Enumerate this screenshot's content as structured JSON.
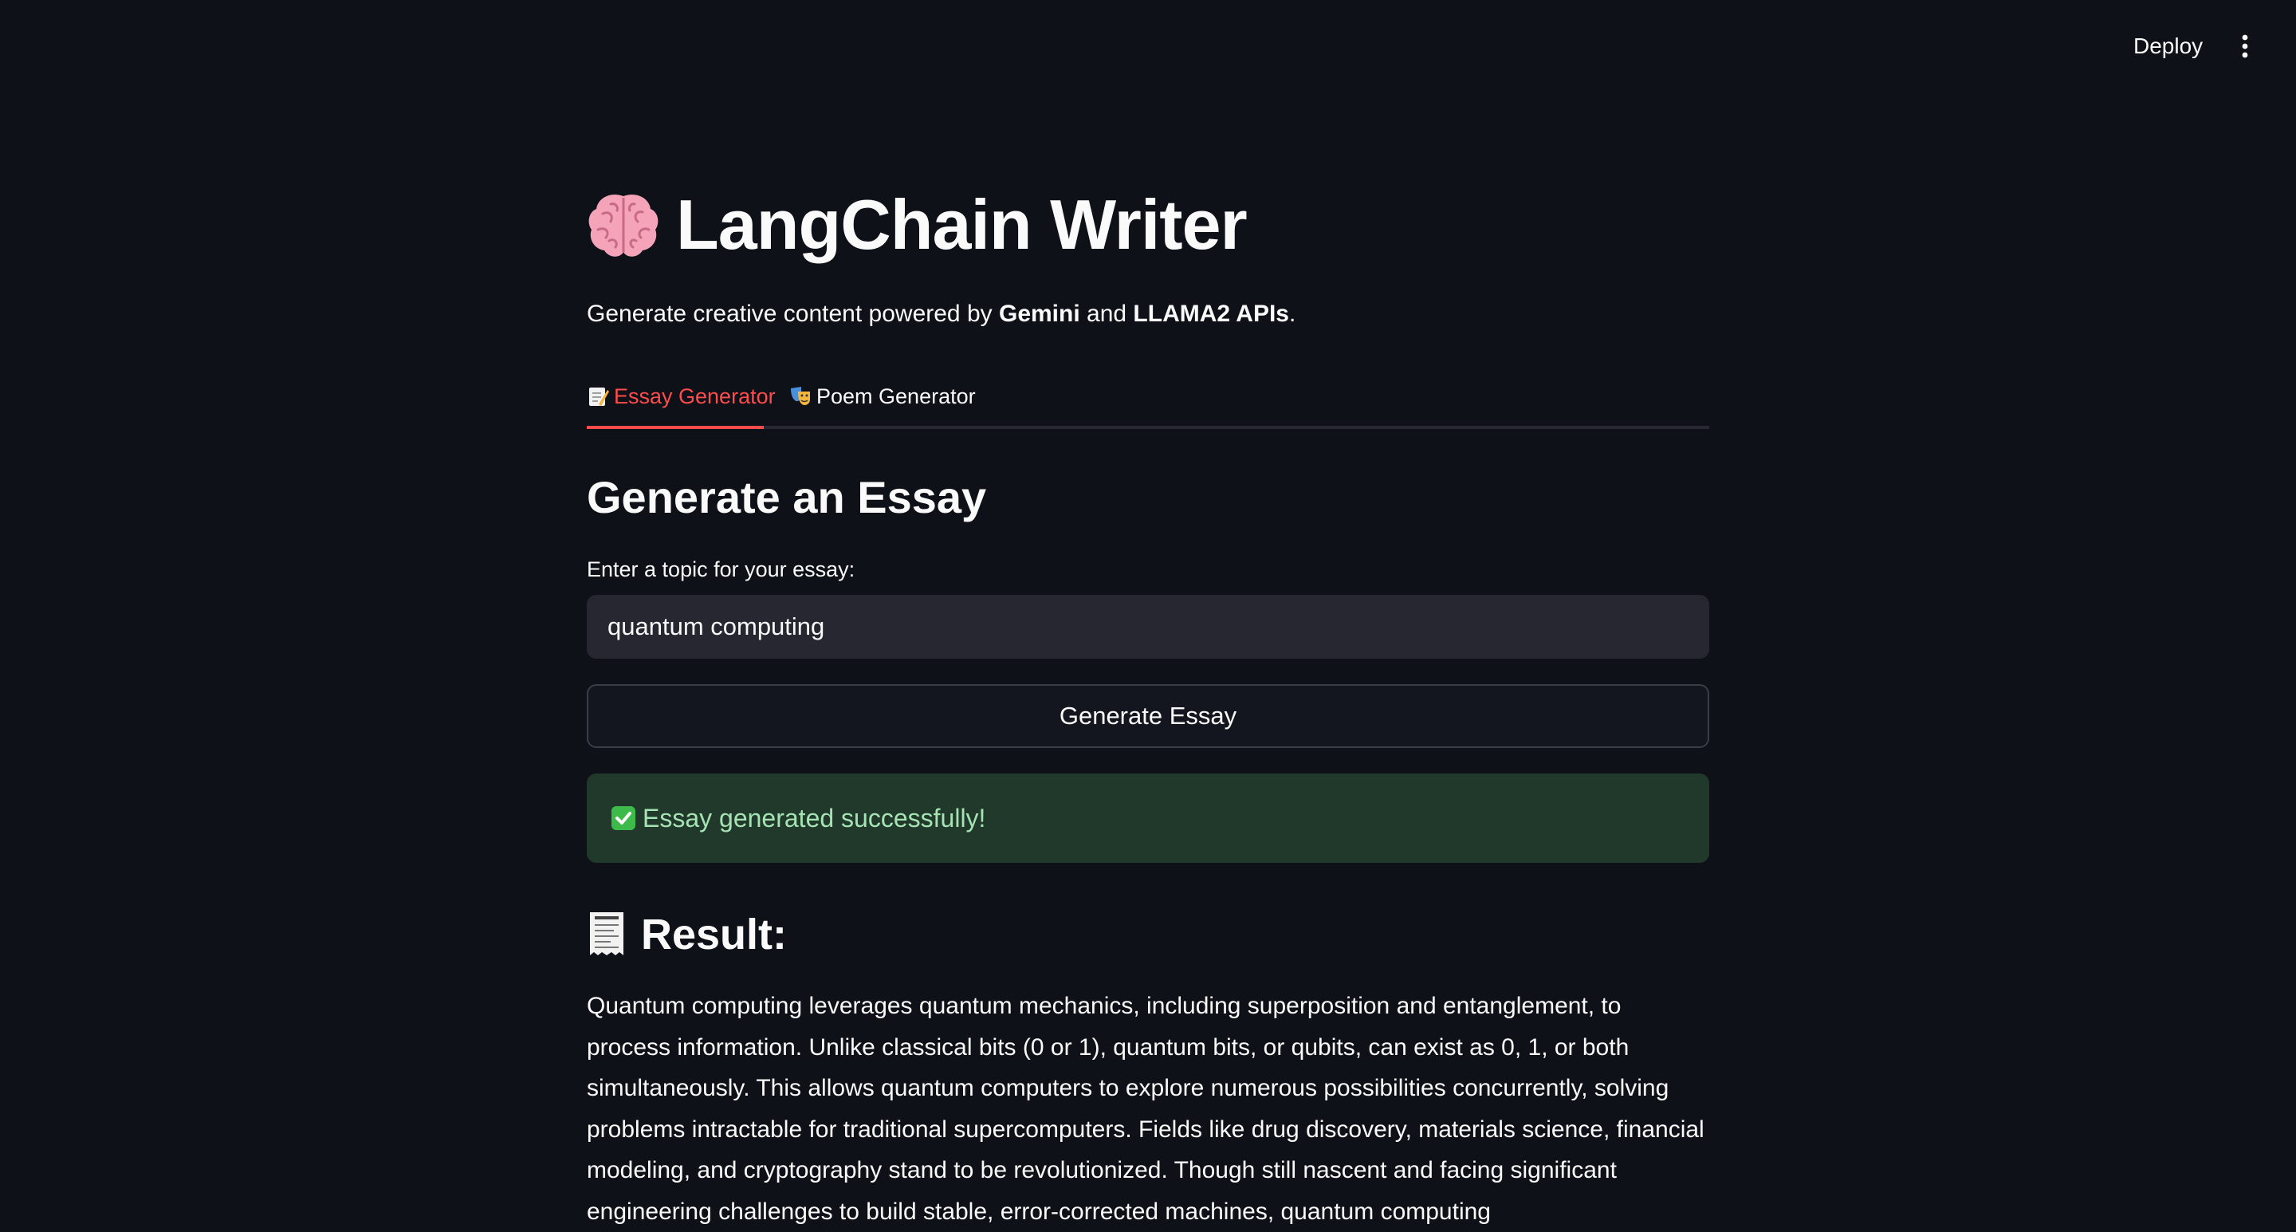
{
  "header": {
    "deploy_label": "Deploy",
    "menu_icon": "vertical-ellipsis-icon"
  },
  "page": {
    "title": "LangChain Writer",
    "title_icon": "brain-emoji",
    "subtitle_prefix": "Generate creative content powered by ",
    "subtitle_bold1": "Gemini",
    "subtitle_mid": " and ",
    "subtitle_bold2": "LLAMA2 APIs",
    "subtitle_suffix": "."
  },
  "tabs": [
    {
      "label": "Essay Generator",
      "icon": "memo-emoji",
      "active": true
    },
    {
      "label": "Poem Generator",
      "icon": "performing-arts-emoji",
      "active": false
    }
  ],
  "essay": {
    "heading": "Generate an Essay",
    "input_label": "Enter a topic for your essay:",
    "input_value": "quantum computing",
    "button_label": "Generate Essay",
    "success_message": "Essay generated successfully!",
    "result_heading": "Result:",
    "result_icon": "receipt-emoji",
    "result_text": "Quantum computing leverages quantum mechanics, including superposition and entanglement, to process information. Unlike classical bits (0 or 1), quantum bits, or qubits, can exist as 0, 1, or both simultaneously. This allows quantum computers to explore numerous possibilities concurrently, solving problems intractable for traditional supercomputers. Fields like drug discovery, materials science, financial modeling, and cryptography stand to be revolutionized. Though still nascent and facing significant engineering challenges to build stable, error-corrected machines, quantum computing"
  },
  "colors": {
    "background": "#0e1117",
    "accent": "#ff4b4b",
    "input_bg": "#262730",
    "success_bg": "#21392b",
    "success_text": "#a6e3b4"
  }
}
